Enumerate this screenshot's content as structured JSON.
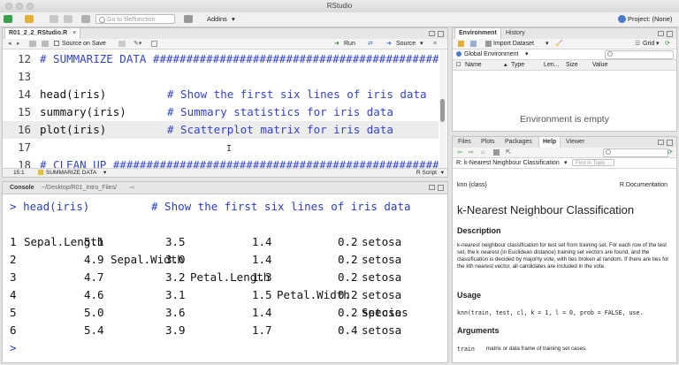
{
  "window": {
    "title": "RStudio"
  },
  "toolbar": {
    "go_to_file_placeholder": "Go to file/function",
    "addins_label": "Addins",
    "project_label": "Project: (None)"
  },
  "source_pane": {
    "tab_label": "R01_2_2_RStudio.R",
    "source_on_save_label": "Source on Save",
    "run_label": "Run",
    "source_label": "Source",
    "lines": [
      {
        "num": "12",
        "code": "# SUMMARIZE DATA #################################################",
        "type": "section"
      },
      {
        "num": "13",
        "code": "",
        "type": "blank"
      },
      {
        "num": "14",
        "code": "head(iris)",
        "comment": "# Show the first six lines of iris data",
        "type": "code"
      },
      {
        "num": "15",
        "code": "summary(iris)",
        "comment": "# Summary statistics for iris data",
        "type": "code"
      },
      {
        "num": "16",
        "code": "plot(iris)",
        "comment": "# Scatterplot matrix for iris data",
        "type": "code"
      },
      {
        "num": "17",
        "code": "",
        "type": "blank"
      },
      {
        "num": "18",
        "code": "# CLEAN UP #######################################################",
        "type": "section"
      }
    ],
    "status_position": "15:1",
    "status_section": "SUMMARIZE DATA",
    "status_filetype": "R Script"
  },
  "console_pane": {
    "tab_label": "Console",
    "path": "~/Desktop/R01_Intro_Files/",
    "command": "head(iris)",
    "command_comment": "# Show the first six lines of iris data",
    "prompt": ">",
    "columns": [
      "Sepal.Length",
      "Sepal.Width",
      "Petal.Length",
      "Petal.Width",
      "Species"
    ],
    "rows": [
      [
        "1",
        "5.1",
        "3.5",
        "1.4",
        "0.2",
        "setosa"
      ],
      [
        "2",
        "4.9",
        "3.0",
        "1.4",
        "0.2",
        "setosa"
      ],
      [
        "3",
        "4.7",
        "3.2",
        "1.3",
        "0.2",
        "setosa"
      ],
      [
        "4",
        "4.6",
        "3.1",
        "1.5",
        "0.2",
        "setosa"
      ],
      [
        "5",
        "5.0",
        "3.6",
        "1.4",
        "0.2",
        "setosa"
      ],
      [
        "6",
        "5.4",
        "3.9",
        "1.7",
        "0.4",
        "setosa"
      ]
    ]
  },
  "env_pane": {
    "tabs": [
      "Environment",
      "History"
    ],
    "import_label": "Import Dataset",
    "grid_label": "Grid",
    "scope_label": "Global Environment",
    "columns": [
      "Name",
      "Type",
      "Len...",
      "Size",
      "Value"
    ],
    "empty_message": "Environment is empty"
  },
  "help_pane": {
    "tabs": [
      "Files",
      "Plots",
      "Packages",
      "Help",
      "Viewer"
    ],
    "topic_label": "R: k-Nearest Neighbour Classification",
    "find_placeholder": "Find in Topic",
    "pkg_label": "knn {class}",
    "doc_label": "R Documentation",
    "title": "k-Nearest Neighbour Classification",
    "description_heading": "Description",
    "description_text": "k-nearest neighbour classification for test set from training set. For each row of the test set, the k nearest (in Euclidean distance) training set vectors are found, and the classification is decided by majority vote, with ties broken at random. If there are ties for the kth nearest vector, all candidates are included in the vote.",
    "usage_heading": "Usage",
    "usage_code": "knn(train, test, cl, k = 1, l = 0, prob = FALSE, use.",
    "arguments_heading": "Arguments",
    "arg_name": "train",
    "arg_desc": "matrix or data frame of training set cases."
  },
  "colors": {
    "comment_blue": "#3344c8",
    "accent": "#4a7ac8"
  }
}
